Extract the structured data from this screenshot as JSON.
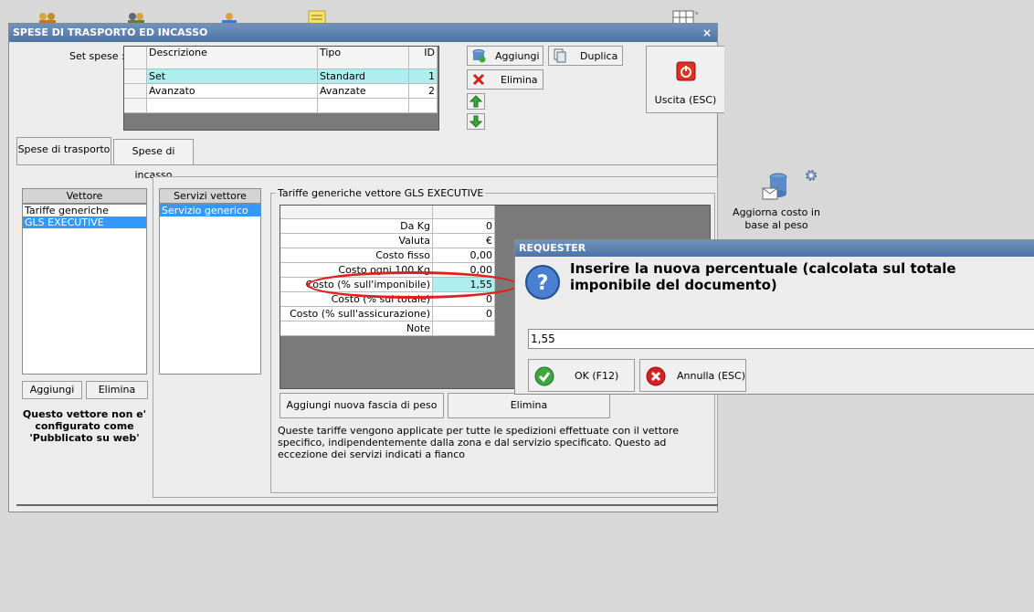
{
  "window": {
    "title": "SPESE DI TRASPORTO ED INCASSO",
    "close_label": "×"
  },
  "set_spese": {
    "label": "Set spese :",
    "columns": [
      "Descrizione",
      "Tipo",
      "ID"
    ],
    "rows": [
      {
        "descrizione": "Set",
        "tipo": "Standard",
        "id": "1"
      },
      {
        "descrizione": "Avanzato",
        "tipo": "Avanzate",
        "id": "2"
      }
    ]
  },
  "toolbar": {
    "aggiungi": "Aggiungi",
    "duplica": "Duplica",
    "elimina": "Elimina",
    "uscita": "Uscita (ESC)"
  },
  "tabs": [
    {
      "label": "Spese di trasporto",
      "active": true
    },
    {
      "label": "Spese di incasso",
      "active": false
    }
  ],
  "vettore": {
    "header": "Vettore",
    "items": [
      "Tariffe generiche",
      "GLS EXECUTIVE"
    ],
    "selected": "GLS EXECUTIVE",
    "aggiungi": "Aggiungi",
    "elimina": "Elimina",
    "note": "Questo vettore non e' configurato come 'Pubblicato su web'"
  },
  "servizi": {
    "header": "Servizi vettore",
    "items": [
      "Servizio generico"
    ]
  },
  "tariffe": {
    "legend": "Tariffe generiche vettore GLS EXECUTIVE",
    "rows": [
      {
        "key": "Da Kg",
        "value": "0"
      },
      {
        "key": "Valuta",
        "value": "€"
      },
      {
        "key": "Costo fisso",
        "value": "0,00"
      },
      {
        "key": "Costo ogni 100 Kg",
        "value": "0,00"
      },
      {
        "key": "Costo (% sull'imponibile)",
        "value": "1,55"
      },
      {
        "key": "Costo (% sul totale)",
        "value": "0"
      },
      {
        "key": "Costo (% sull'assicurazione)",
        "value": "0"
      },
      {
        "key": "Note",
        "value": ""
      }
    ],
    "aggiungi_fascia": "Aggiungi nuova fascia di peso",
    "elimina": "Elimina",
    "info": "Queste tariffe vengono applicate per tutte le spedizioni effettuate con il vettore specifico, indipendentemente dalla zona e dal servizio specificato. Questo ad eccezione dei servizi indicati a fianco"
  },
  "aggiorna": {
    "label": "Aggiorna costo in base al peso"
  },
  "requester": {
    "title": "REQUESTER",
    "question": "Inserire la nuova percentuale (calcolata sul totale imponibile del documento)",
    "value": "1,55",
    "ok": "OK (F12)",
    "annulla": "Annulla (ESC)"
  }
}
